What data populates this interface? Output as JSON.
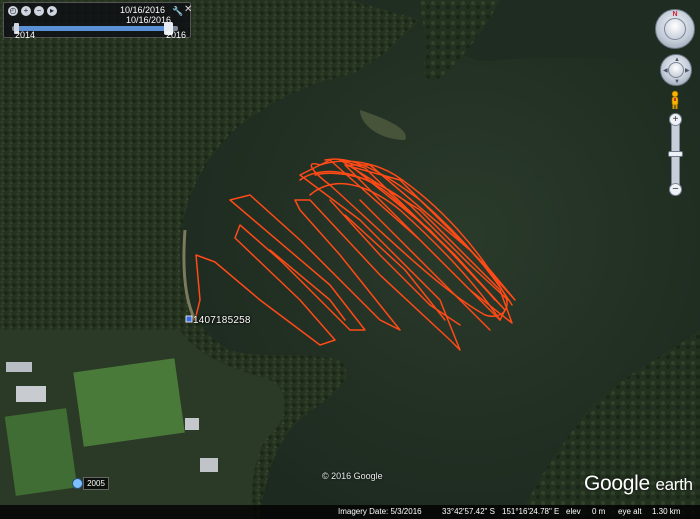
{
  "time_slider": {
    "current_date_top": "10/16/2016",
    "current_date": "10/16/2016",
    "start_year": "2014",
    "end_year": "2016",
    "position_fraction": 0.95,
    "icons": [
      "clock-icon",
      "zoom-in-icon",
      "zoom-out-icon",
      "play-icon"
    ]
  },
  "placemark": {
    "label": "1407185258"
  },
  "map": {
    "copyright": "© 2016 Google",
    "brand_main": "Google",
    "brand_sub": "earth",
    "track_color": "#ff4a17"
  },
  "historical": {
    "year": "2005"
  },
  "status_bar": {
    "imagery_date": "Imagery Date: 5/3/2016",
    "latitude": "33°42'57.42\" S",
    "longitude": "151°16'24.78\" E",
    "elev_label": "elev",
    "elev_value": "0 m",
    "eye_alt_label": "eye alt",
    "eye_alt_value": "1.30 km"
  },
  "navigation": {
    "north_label": "N"
  }
}
